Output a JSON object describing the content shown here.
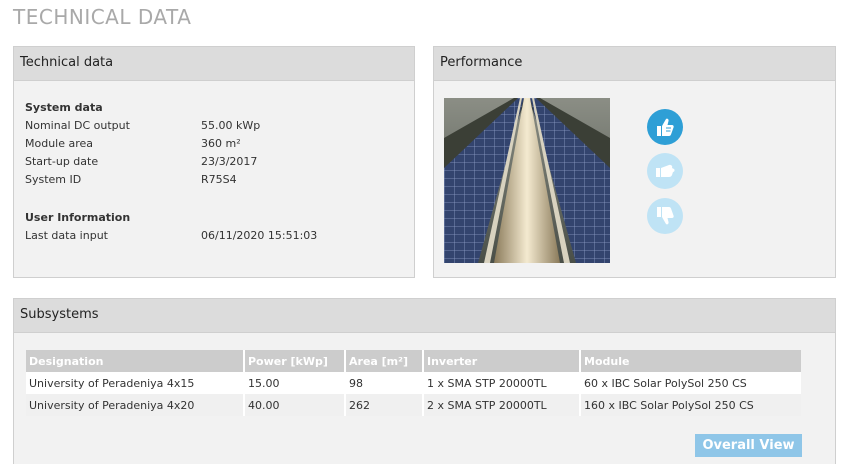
{
  "page_title": "TECHNICAL DATA",
  "technical": {
    "header": "Technical data",
    "system_heading": "System data",
    "system_rows": [
      {
        "label": "Nominal DC output",
        "value": "55.00 kWp"
      },
      {
        "label": "Module area",
        "value": "360 m²"
      },
      {
        "label": "Start-up date",
        "value": "23/3/2017"
      },
      {
        "label": "System ID",
        "value": "R75S4"
      }
    ],
    "user_heading": "User Information",
    "user_rows": [
      {
        "label": "Last data input",
        "value": "06/11/2020 15:51:03"
      }
    ]
  },
  "performance": {
    "header": "Performance",
    "photo_icon": "solar-panel-row-photo",
    "ratings": [
      {
        "icon": "thumbs-up-icon",
        "state": "active",
        "color": "#2e9fd6"
      },
      {
        "icon": "thumbs-neutral-icon",
        "state": "inactive",
        "color": "#bfe3f5"
      },
      {
        "icon": "thumbs-down-icon",
        "state": "inactive",
        "color": "#bfe3f5"
      }
    ]
  },
  "subsystems": {
    "header": "Subsystems",
    "columns": [
      "Designation",
      "Power [kWp]",
      "Area [m²]",
      "Inverter",
      "Module"
    ],
    "rows": [
      [
        "University of Peradeniya 4x15",
        "15.00",
        "98",
        "1 x SMA STP 20000TL",
        "60 x IBC Solar PolySol 250 CS"
      ],
      [
        "University of Peradeniya 4x20",
        "40.00",
        "262",
        "2 x SMA STP 20000TL",
        "160 x IBC Solar PolySol 250 CS"
      ]
    ],
    "overall_button": "Overall View"
  }
}
